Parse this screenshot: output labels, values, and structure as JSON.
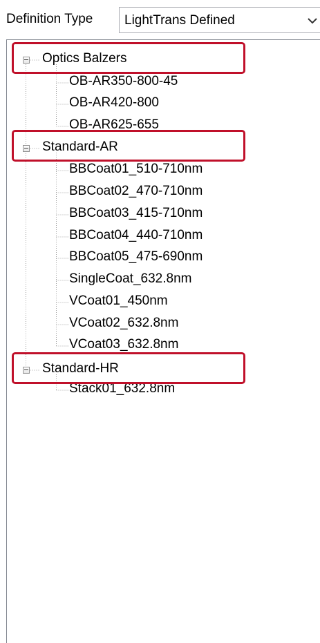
{
  "definition_type": {
    "label": "Definition Type",
    "selected_value": "LightTrans Defined"
  },
  "tree": {
    "groups": [
      {
        "label": "Optics Balzers",
        "expanded": true,
        "highlighted": true,
        "items": [
          "OB-AR350-800-45",
          "OB-AR420-800",
          "OB-AR625-655"
        ]
      },
      {
        "label": "Standard-AR",
        "expanded": true,
        "highlighted": true,
        "items": [
          "BBCoat01_510-710nm",
          "BBCoat02_470-710nm",
          "BBCoat03_415-710nm",
          "BBCoat04_440-710nm",
          "BBCoat05_475-690nm",
          "SingleCoat_632.8nm",
          "VCoat01_450nm",
          "VCoat02_632.8nm",
          "VCoat03_632.8nm"
        ]
      },
      {
        "label": "Standard-HR",
        "expanded": true,
        "highlighted": true,
        "items": [
          "Stack01_632.8nm"
        ]
      }
    ]
  },
  "colors": {
    "highlight": "#c0102a",
    "tree_lines": "#a0a0a0",
    "border": "#828790"
  }
}
